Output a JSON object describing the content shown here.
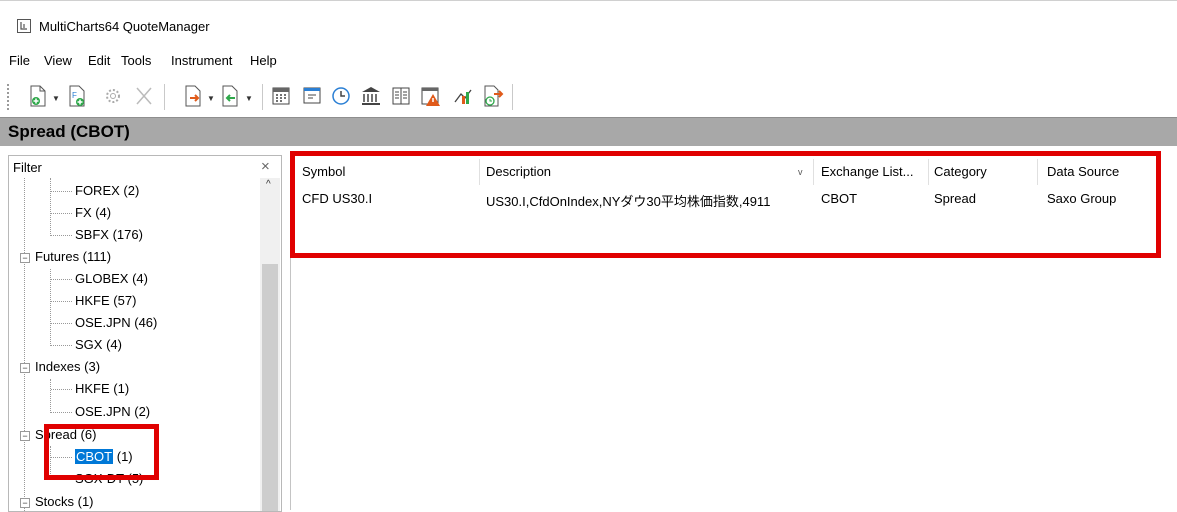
{
  "window": {
    "title": "MultiCharts64 QuoteManager"
  },
  "menu": [
    "File",
    "View",
    "Edit",
    "Tools",
    "Instrument",
    "Help"
  ],
  "header": {
    "title": "Spread (CBOT)"
  },
  "filter": {
    "label": "Filter",
    "close": "×"
  },
  "tree": {
    "forex_items": [
      "FOREX (2)",
      "FX (4)",
      "SBFX (176)"
    ],
    "futures": "Futures (111)",
    "futures_items": [
      "GLOBEX (4)",
      "HKFE (57)",
      "OSE.JPN (46)",
      "SGX (4)"
    ],
    "indexes": "Indexes (3)",
    "indexes_items": [
      "HKFE (1)",
      "OSE.JPN (2)"
    ],
    "spread": "Spread (6)",
    "spread_selected": "CBOT",
    "spread_selected_count": "(1)",
    "spread_other": "SGX-DT (5)",
    "stocks": "Stocks (1)"
  },
  "table": {
    "columns": [
      "Symbol",
      "Description",
      "Exchange List...",
      "Category",
      "Data Source"
    ],
    "rows": [
      [
        "CFD US30.I",
        "US30.I,CfdOnIndex,NYダウ30平均株価指数,4911",
        "CBOT",
        "Spread",
        "Saxo Group"
      ]
    ]
  },
  "colors": {
    "highlight_border": "#e00000",
    "selection": "#0078d7",
    "header_bar": "#a8a8a8"
  }
}
